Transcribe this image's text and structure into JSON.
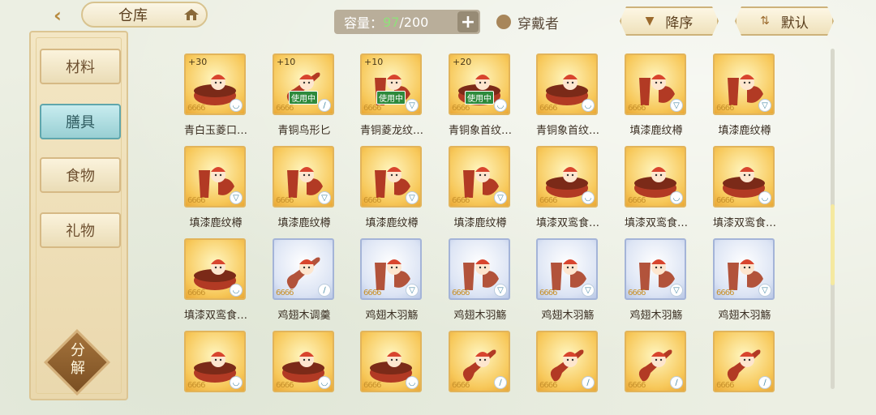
{
  "header": {
    "back_icon": "chevron-left-icon",
    "title": "仓库",
    "capacity_label": "容量：",
    "capacity_current": "97",
    "capacity_max": "/200",
    "worn_label": "穿戴者",
    "sort_order_label": "降序",
    "sort_mode_label": "默认"
  },
  "sidebar": {
    "items": [
      {
        "label": "材料",
        "active": false
      },
      {
        "label": "膳具",
        "active": true
      },
      {
        "label": "食物",
        "active": false
      },
      {
        "label": "礼物",
        "active": false
      }
    ],
    "decompose_label_1": "分",
    "decompose_label_2": "解"
  },
  "colors": {
    "accent_active": "#98cfd3",
    "inuse_green": "#2e8a3c",
    "capacity_current": "#8fe07a"
  },
  "items": [
    {
      "name": "青白玉菱口…",
      "badge": "+30",
      "stars": "6666",
      "inuse": "",
      "theme": "gold",
      "type": "bowl"
    },
    {
      "name": "青铜鸟形匕",
      "badge": "+10",
      "stars": "6666",
      "inuse": "使用中",
      "theme": "gold",
      "type": "spoon"
    },
    {
      "name": "青铜菱龙纹…",
      "badge": "+10",
      "stars": "6666",
      "inuse": "使用中",
      "theme": "gold",
      "type": "cup"
    },
    {
      "name": "青铜象首纹…",
      "badge": "+20",
      "stars": "6666",
      "inuse": "使用中",
      "theme": "gold",
      "type": "bowl"
    },
    {
      "name": "青铜象首纹…",
      "badge": "",
      "stars": "6666",
      "inuse": "",
      "theme": "gold",
      "type": "bowl"
    },
    {
      "name": "填漆鹿纹樽",
      "badge": "",
      "stars": "6666",
      "inuse": "",
      "theme": "gold",
      "type": "cup"
    },
    {
      "name": "填漆鹿纹樽",
      "badge": "",
      "stars": "6666",
      "inuse": "",
      "theme": "gold",
      "type": "cup"
    },
    {
      "name": "填漆鹿纹樽",
      "badge": "",
      "stars": "6666",
      "inuse": "",
      "theme": "gold",
      "type": "cup"
    },
    {
      "name": "填漆鹿纹樽",
      "badge": "",
      "stars": "6666",
      "inuse": "",
      "theme": "gold",
      "type": "cup"
    },
    {
      "name": "填漆鹿纹樽",
      "badge": "",
      "stars": "6666",
      "inuse": "",
      "theme": "gold",
      "type": "cup"
    },
    {
      "name": "填漆鹿纹樽",
      "badge": "",
      "stars": "6666",
      "inuse": "",
      "theme": "gold",
      "type": "cup"
    },
    {
      "name": "填漆双鸾食…",
      "badge": "",
      "stars": "6666",
      "inuse": "",
      "theme": "gold",
      "type": "bowl"
    },
    {
      "name": "填漆双鸾食…",
      "badge": "",
      "stars": "6666",
      "inuse": "",
      "theme": "gold",
      "type": "bowl"
    },
    {
      "name": "填漆双鸾食…",
      "badge": "",
      "stars": "6666",
      "inuse": "",
      "theme": "gold",
      "type": "bowl"
    },
    {
      "name": "填漆双鸾食…",
      "badge": "",
      "stars": "6666",
      "inuse": "",
      "theme": "gold",
      "type": "bowl"
    },
    {
      "name": "鸡翅木调羹",
      "badge": "",
      "stars": "6666",
      "inuse": "",
      "theme": "blue",
      "type": "spoon"
    },
    {
      "name": "鸡翅木羽觞",
      "badge": "",
      "stars": "6666",
      "inuse": "",
      "theme": "blue",
      "type": "cup"
    },
    {
      "name": "鸡翅木羽觞",
      "badge": "",
      "stars": "6666",
      "inuse": "",
      "theme": "blue",
      "type": "cup"
    },
    {
      "name": "鸡翅木羽觞",
      "badge": "",
      "stars": "6666",
      "inuse": "",
      "theme": "blue",
      "type": "cup"
    },
    {
      "name": "鸡翅木羽觞",
      "badge": "",
      "stars": "6666",
      "inuse": "",
      "theme": "blue",
      "type": "cup"
    },
    {
      "name": "鸡翅木羽觞",
      "badge": "",
      "stars": "6666",
      "inuse": "",
      "theme": "blue",
      "type": "cup"
    },
    {
      "name": "",
      "badge": "",
      "stars": "6666",
      "inuse": "",
      "theme": "gold",
      "type": "bowl"
    },
    {
      "name": "",
      "badge": "",
      "stars": "6666",
      "inuse": "",
      "theme": "gold",
      "type": "bowl"
    },
    {
      "name": "",
      "badge": "",
      "stars": "6666",
      "inuse": "",
      "theme": "gold",
      "type": "bowl"
    },
    {
      "name": "",
      "badge": "",
      "stars": "6666",
      "inuse": "",
      "theme": "gold",
      "type": "spoon"
    },
    {
      "name": "",
      "badge": "",
      "stars": "6666",
      "inuse": "",
      "theme": "gold",
      "type": "spoon"
    },
    {
      "name": "",
      "badge": "",
      "stars": "6666",
      "inuse": "",
      "theme": "gold",
      "type": "spoon"
    },
    {
      "name": "",
      "badge": "",
      "stars": "6666",
      "inuse": "",
      "theme": "gold",
      "type": "spoon"
    }
  ]
}
